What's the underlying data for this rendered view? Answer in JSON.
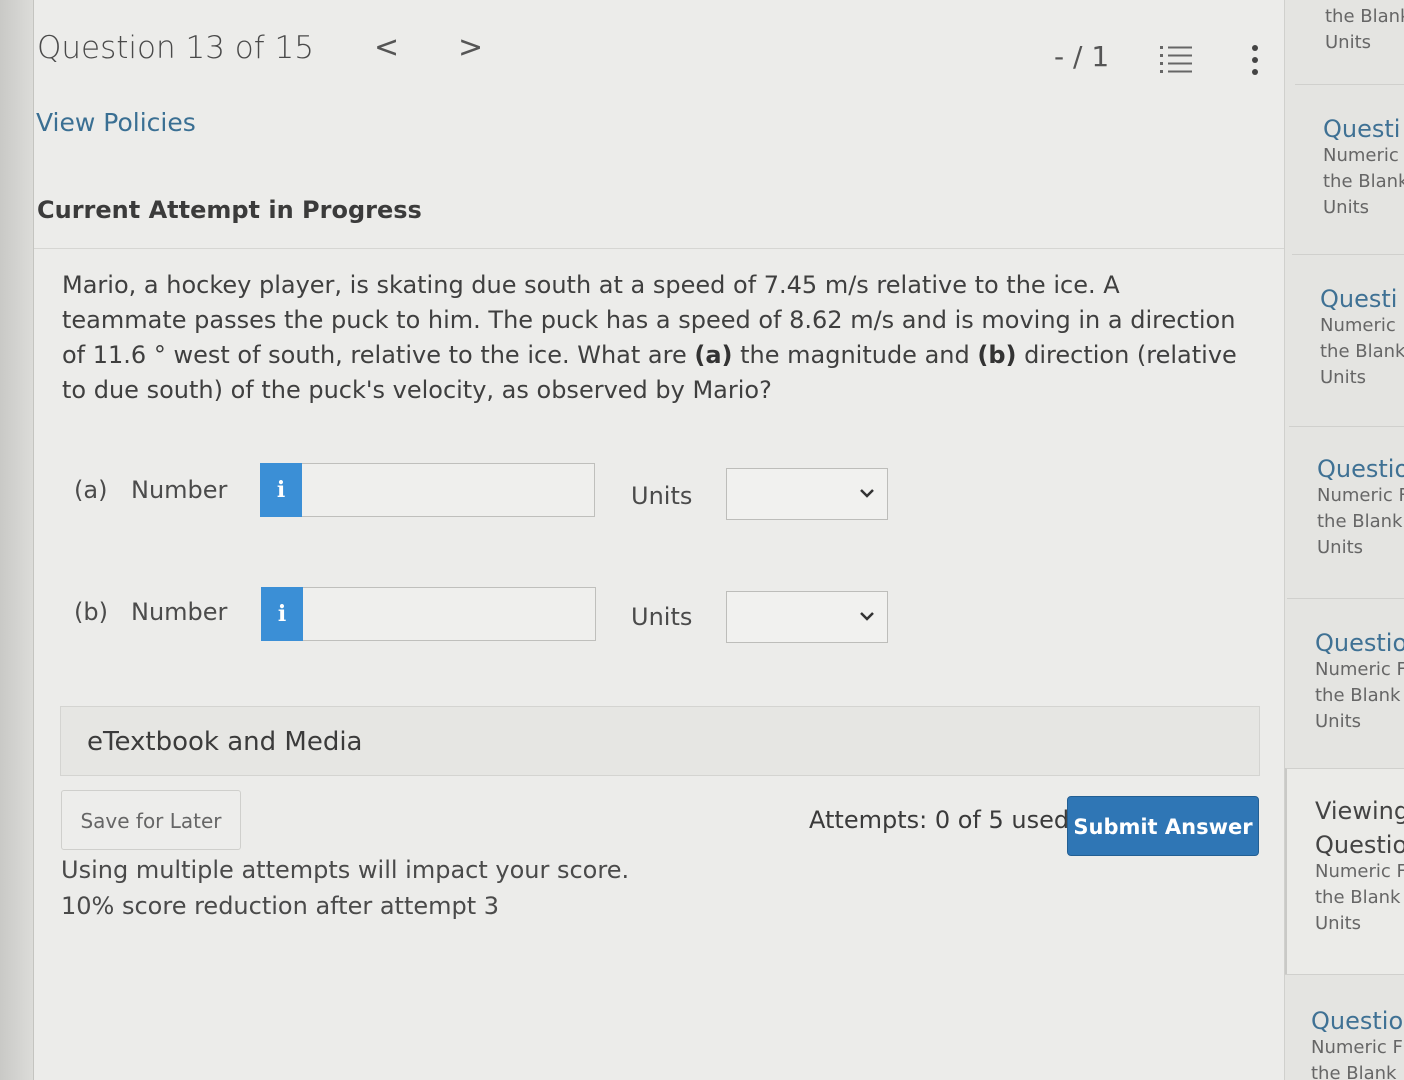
{
  "header": {
    "question_title": "Question 13 of 15",
    "prev_arrow": "<",
    "next_arrow": ">",
    "score": "- / 1"
  },
  "view_policies": "View Policies",
  "attempt_heading": "Current Attempt in Progress",
  "question": {
    "text_part1": "Mario, a hockey player, is skating due south at a speed of 7.45 m/s relative to the ice. A teammate passes the puck to him. The puck has a speed of 8.62 m/s and is moving in a direction of 11.6 ° west of south, relative to the ice. What are ",
    "a_marker": "(a)",
    "text_part2": " the magnitude and ",
    "b_marker": "(b)",
    "text_part3": " direction (relative to due south) of the puck's velocity, as observed by Mario?"
  },
  "answers": [
    {
      "part": "(a)",
      "label": "Number",
      "info": "i",
      "value": "",
      "units_label": "Units",
      "unit_value": ""
    },
    {
      "part": "(b)",
      "label": "Number",
      "info": "i",
      "value": "",
      "units_label": "Units",
      "unit_value": ""
    }
  ],
  "etextbook": "eTextbook and Media",
  "save_label": "Save for Later",
  "attempts_text": "Attempts: 0 of 5 used",
  "submit_label": "Submit Answer",
  "warning_line1": "Using multiple attempts will impact your score.",
  "warning_line2": "10% score reduction after attempt 3",
  "sidebar": {
    "top_lines": [
      "the Blank",
      "Units"
    ],
    "items": [
      {
        "title": "Questi",
        "lines": [
          "Numeric",
          "the Blank",
          "Units"
        ]
      },
      {
        "title": "Questi",
        "lines": [
          "Numeric",
          "the Blank",
          "Units"
        ]
      },
      {
        "title": "Questio",
        "lines": [
          "Numeric F",
          "the Blank",
          "Units"
        ]
      },
      {
        "title": "Questio",
        "lines": [
          "Numeric F",
          "the Blank",
          "Units"
        ]
      },
      {
        "viewing": "Viewing",
        "title": "Questio",
        "lines": [
          "Numeric F",
          "the Blank",
          "Units"
        ]
      },
      {
        "title": "Questio",
        "lines": [
          "Numeric F",
          "the Blank"
        ]
      }
    ]
  },
  "colors": {
    "accent": "#2f76b5",
    "info_button": "#3b8fd6",
    "link": "#3a6f93"
  }
}
